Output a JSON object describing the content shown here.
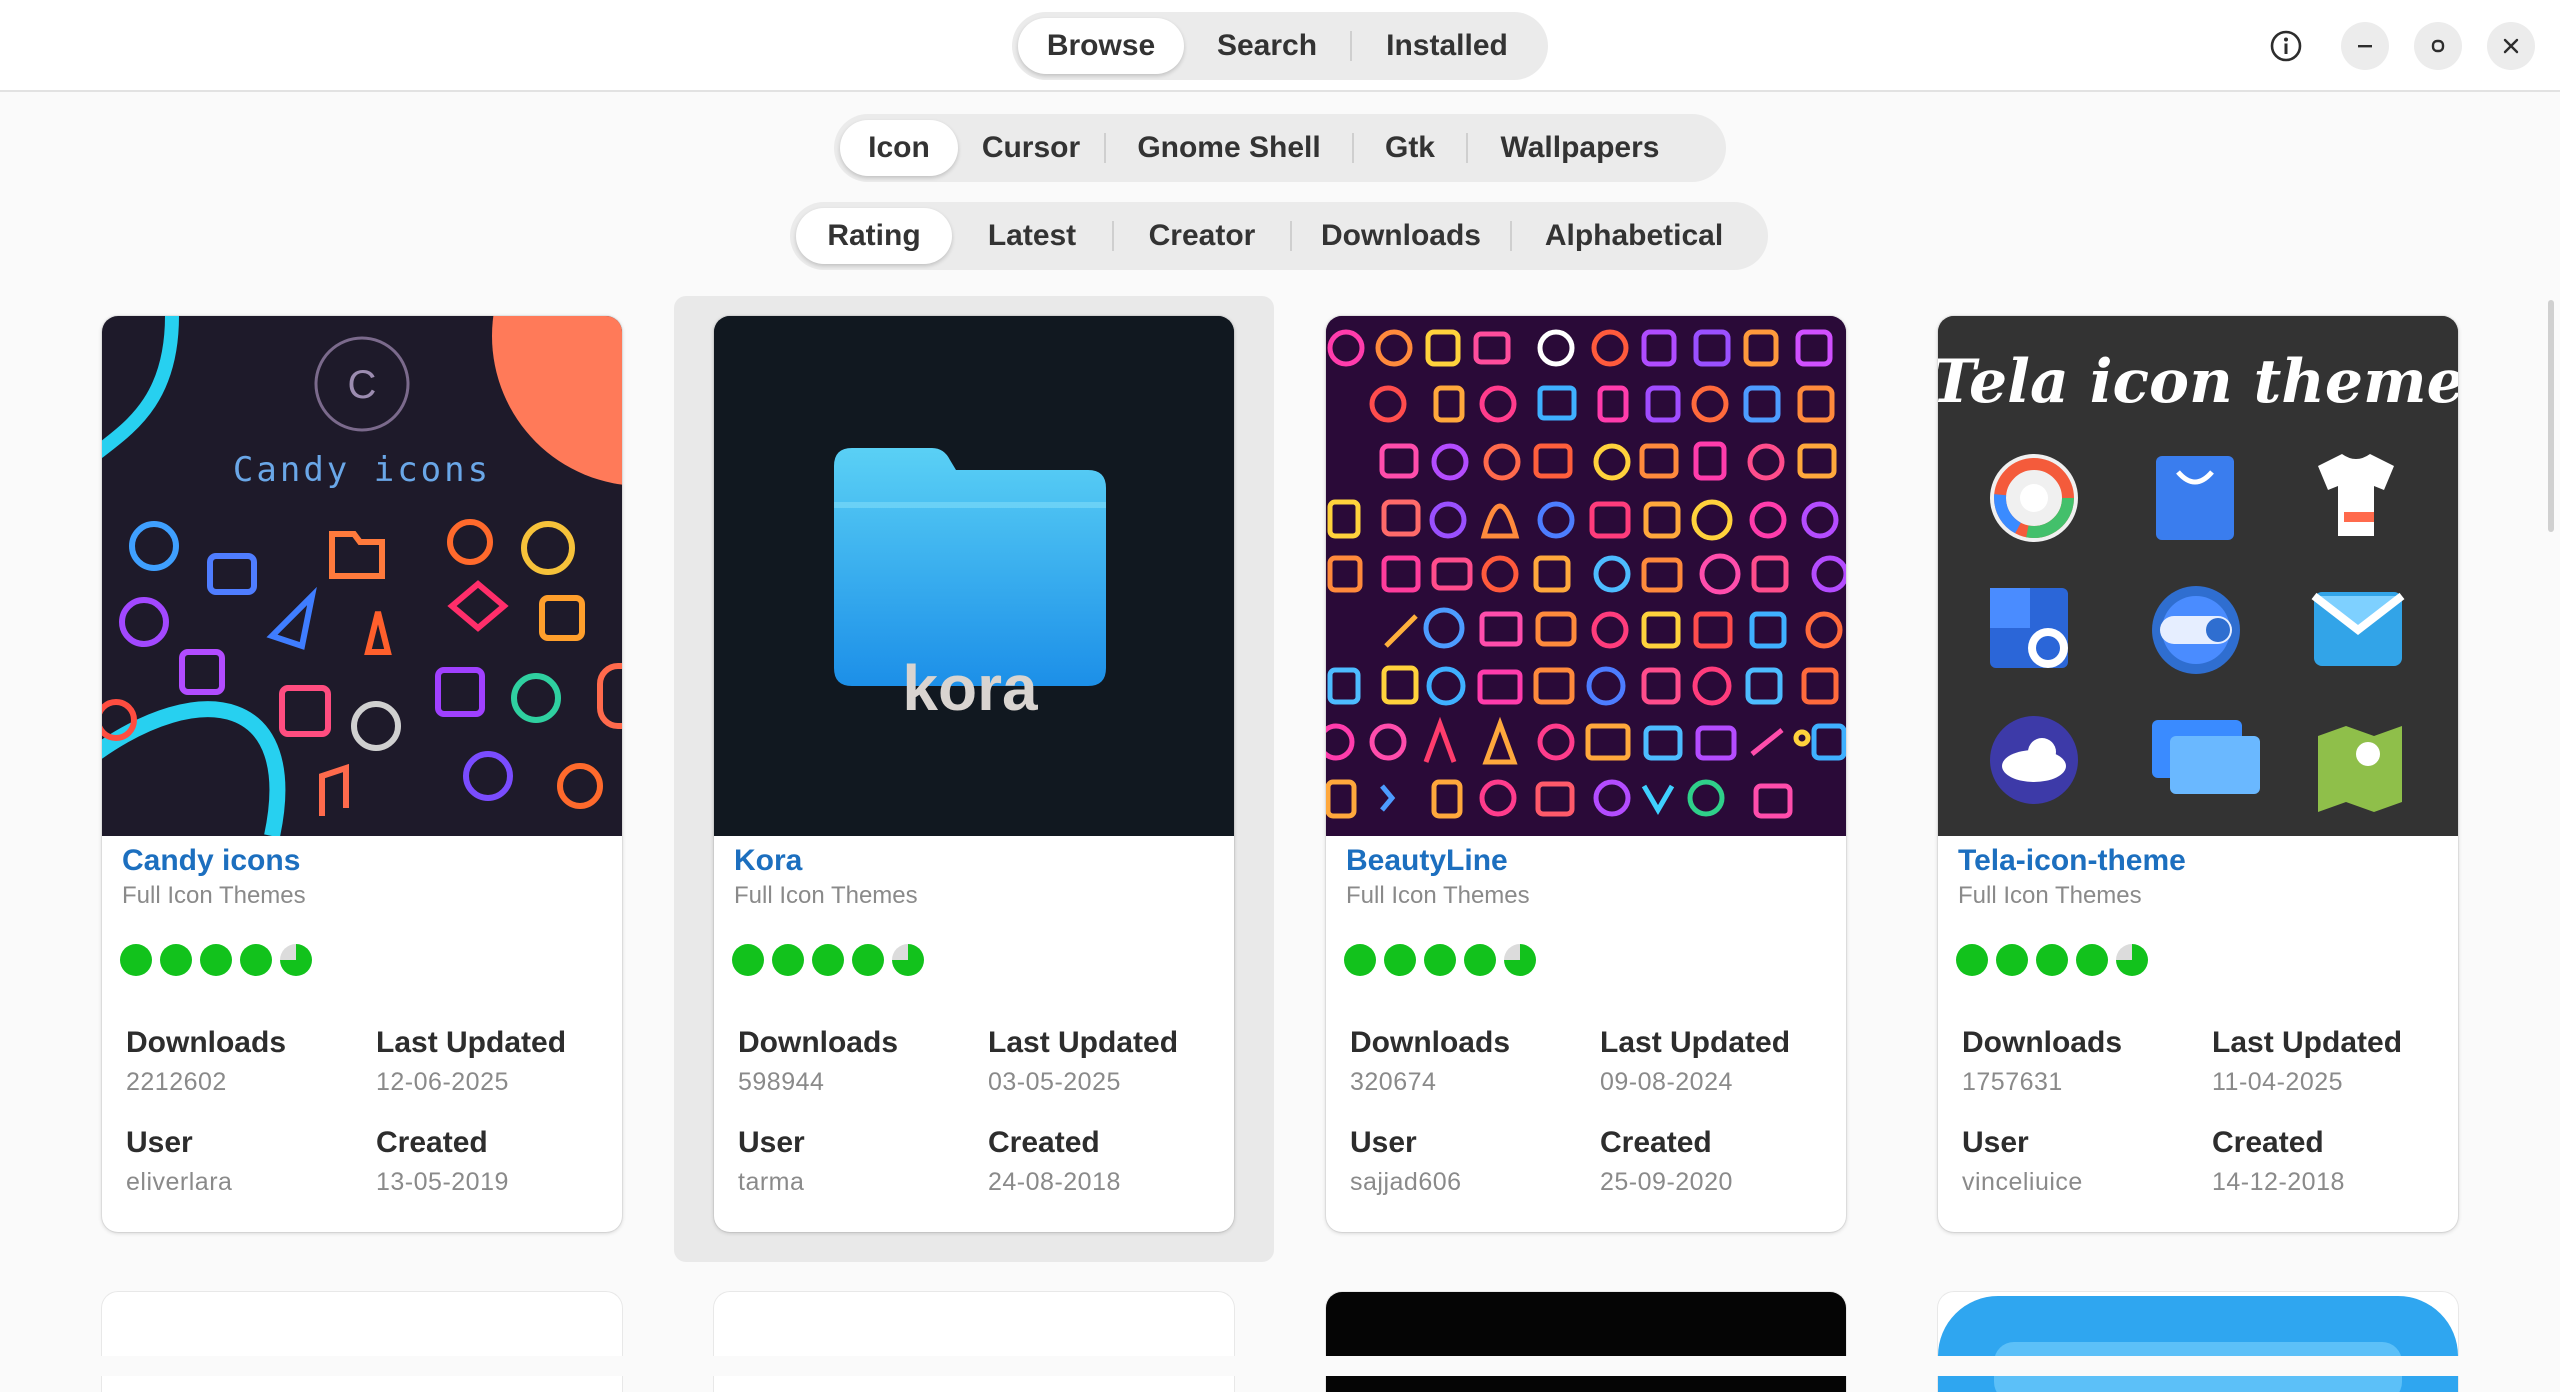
{
  "header": {
    "tabs": [
      {
        "label": "Browse",
        "active": true
      },
      {
        "label": "Search",
        "active": false
      },
      {
        "label": "Installed",
        "active": false
      }
    ],
    "buttons": {
      "info": "info-icon",
      "minimize": "minimize-icon",
      "maximize": "maximize-icon",
      "close": "close-icon"
    }
  },
  "categories": [
    {
      "label": "Icon",
      "active": true
    },
    {
      "label": "Cursor",
      "active": false
    },
    {
      "label": "Gnome Shell",
      "active": false
    },
    {
      "label": "Gtk",
      "active": false
    },
    {
      "label": "Wallpapers",
      "active": false
    }
  ],
  "sort": [
    {
      "label": "Rating",
      "active": true
    },
    {
      "label": "Latest",
      "active": false
    },
    {
      "label": "Creator",
      "active": false
    },
    {
      "label": "Downloads",
      "active": false
    },
    {
      "label": "Alphabetical",
      "active": false
    }
  ],
  "labels": {
    "downloads": "Downloads",
    "last_updated": "Last Updated",
    "user": "User",
    "created": "Created"
  },
  "cards": [
    {
      "title": "Candy icons",
      "subtitle": "Full Icon Themes",
      "rating": 0.9,
      "downloads": "2212602",
      "last_updated": "12-06-2025",
      "user": "eliverlara",
      "created": "13-05-2019",
      "thumb_text": "Candy icons"
    },
    {
      "title": "Kora",
      "subtitle": "Full Icon Themes",
      "rating": 0.9,
      "downloads": "598944",
      "last_updated": "03-05-2025",
      "user": "tarma",
      "created": "24-08-2018",
      "thumb_text": "kora"
    },
    {
      "title": "BeautyLine",
      "subtitle": "Full Icon Themes",
      "rating": 0.9,
      "downloads": "320674",
      "last_updated": "09-08-2024",
      "user": "sajjad606",
      "created": "25-09-2020"
    },
    {
      "title": "Tela-icon-theme",
      "subtitle": "Full Icon Themes",
      "rating": 0.9,
      "downloads": "1757631",
      "last_updated": "11-04-2025",
      "user": "vinceliuice",
      "created": "14-12-2018",
      "thumb_text": "Tela icon theme"
    }
  ],
  "colors": {
    "accent": "#1c6fbf",
    "rating": "#12c21c"
  }
}
